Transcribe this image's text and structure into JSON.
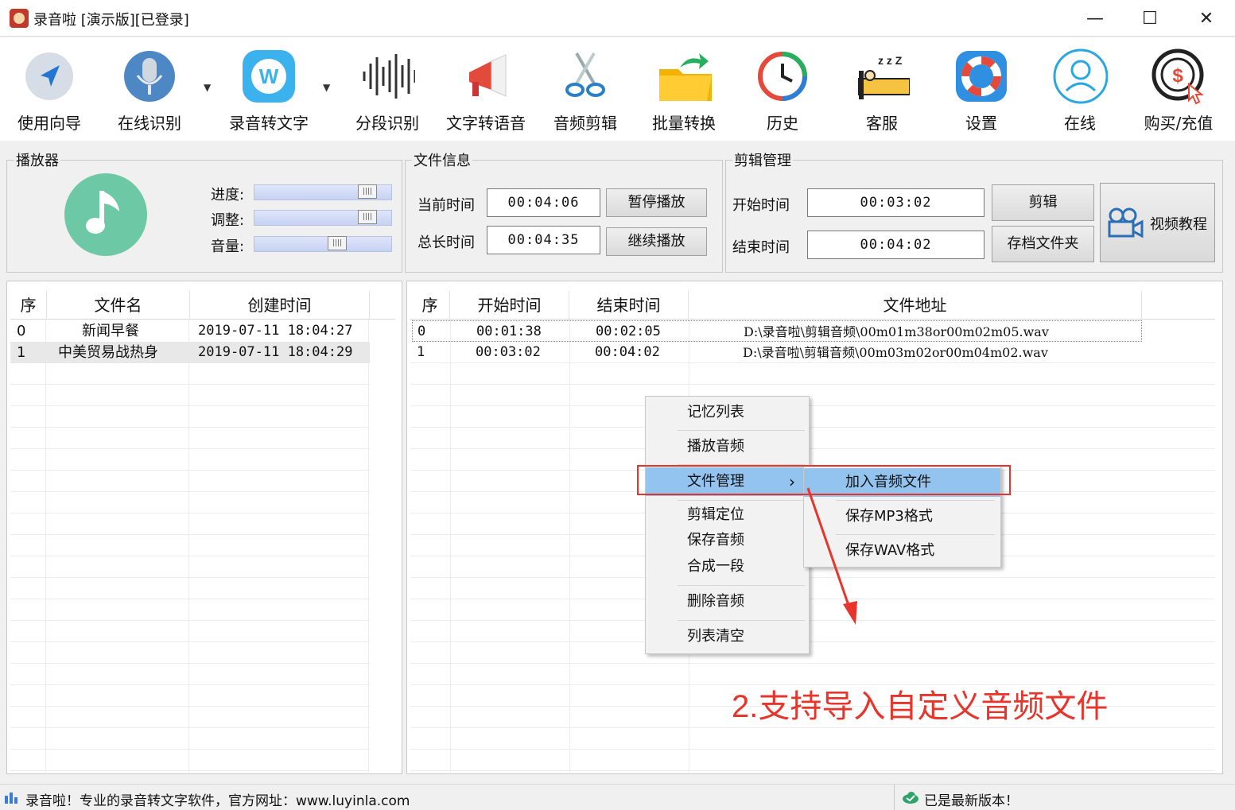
{
  "window": {
    "title": "录音啦 [演示版][已登录]",
    "min": "—",
    "max": "☐",
    "close": "✕"
  },
  "toolbar": [
    {
      "label": "使用向导",
      "icon": "navigate-arrow-icon"
    },
    {
      "label": "在线识别",
      "icon": "microphone-icon"
    },
    {
      "label": "录音转文字",
      "icon": "w-logo-icon"
    },
    {
      "label": "分段识别",
      "icon": "waveform-icon"
    },
    {
      "label": "文字转语音",
      "icon": "megaphone-icon"
    },
    {
      "label": "音频剪辑",
      "icon": "scissors-icon"
    },
    {
      "label": "批量转换",
      "icon": "folder-arrow-icon"
    },
    {
      "label": "历史",
      "icon": "history-clock-icon"
    },
    {
      "label": "客服",
      "icon": "sleeping-bed-icon"
    },
    {
      "label": "设置",
      "icon": "lifebuoy-icon"
    },
    {
      "label": "在线",
      "icon": "user-circle-icon"
    },
    {
      "label": "购买/充值",
      "icon": "coin-cursor-icon"
    }
  ],
  "dropdown_caret": "▼",
  "player": {
    "title": "播放器",
    "progress_label": "进度:",
    "adjust_label": "调整:",
    "volume_label": "音量:",
    "progress_level": 0.82,
    "adjust_level": 0.82,
    "volume_level": 0.58,
    "thumb_grip": "||||"
  },
  "fileinfo": {
    "title": "文件信息",
    "current_label": "当前时间",
    "current_value": "00:04:06",
    "total_label": "总长时间",
    "total_value": "00:04:35",
    "pause_button": "暂停播放",
    "resume_button": "继续播放"
  },
  "clip": {
    "title": "剪辑管理",
    "start_label": "开始时间",
    "start_value": "00:03:02",
    "end_label": "结束时间",
    "end_value": "00:04:02",
    "clip_button": "剪辑",
    "folder_button": "存档文件夹",
    "tutorial_button": "视频教程"
  },
  "left_table": {
    "headers": [
      "序",
      "文件名",
      "创建时间"
    ],
    "rows": [
      [
        "0",
        "新闻早餐",
        "2019-07-11 18:04:27"
      ],
      [
        "1",
        "中美贸易战热身",
        "2019-07-11 18:04:29"
      ]
    ]
  },
  "right_table": {
    "headers": [
      "序",
      "开始时间",
      "结束时间",
      "文件地址"
    ],
    "rows": [
      [
        "0",
        "00:01:38",
        "00:02:05",
        "D:\\录音啦\\剪辑音频\\00m01m38or00m02m05.wav"
      ],
      [
        "1",
        "00:03:02",
        "00:04:02",
        "D:\\录音啦\\剪辑音频\\00m03m02or00m04m02.wav"
      ]
    ]
  },
  "context_menu": {
    "items": [
      "记忆列表",
      "播放音频",
      "文件管理",
      "剪辑定位",
      "保存音频",
      "合成一段",
      "删除音频",
      "列表清空"
    ],
    "submenu_arrow": "›",
    "submenu": [
      "加入音频文件",
      "保存MP3格式",
      "保存WAV格式"
    ]
  },
  "annotation": {
    "text": "2.支持导入自定义音频文件",
    "color": "#e8352b"
  },
  "status": {
    "left_text": "录音啦！专业的录音转文字软件，官方网址：www.luyinla.com",
    "right_text": "已是最新版本！"
  }
}
